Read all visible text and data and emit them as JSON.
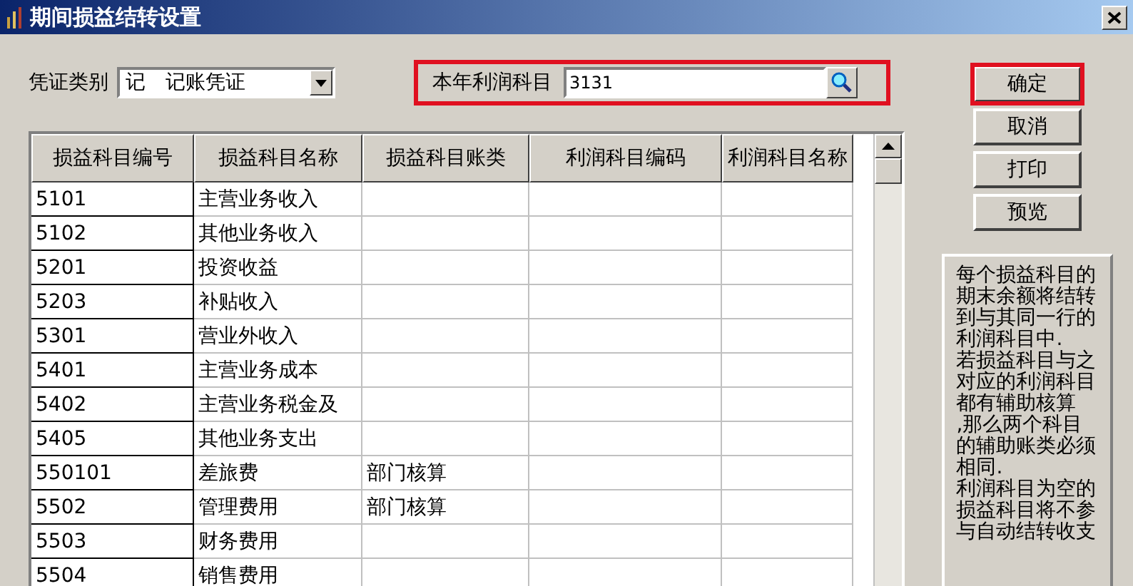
{
  "window": {
    "title": "期间损益结转设置"
  },
  "voucher_type": {
    "label": "凭证类别",
    "code": "记",
    "name": "记账凭证"
  },
  "profit_account": {
    "label": "本年利润科目",
    "value": "3131",
    "highlighted": true
  },
  "buttons": [
    {
      "label": "确定",
      "highlighted": true
    },
    {
      "label": "取消",
      "highlighted": false
    },
    {
      "label": "打印",
      "highlighted": false
    },
    {
      "label": "预览",
      "highlighted": false
    }
  ],
  "table": {
    "columns": [
      "损益科目编号",
      "损益科目名称",
      "损益科目账类",
      "利润科目编码",
      "利润科目名称"
    ],
    "rows": [
      {
        "code": "5101",
        "name": "主营业务收入"
      },
      {
        "code": "5102",
        "name": "其他业务收入"
      },
      {
        "code": "5201",
        "name": "投资收益"
      },
      {
        "code": "5203",
        "name": "补贴收入"
      },
      {
        "code": "5301",
        "name": "营业外收入"
      },
      {
        "code": "5401",
        "name": "主营业务成本"
      },
      {
        "code": "5402",
        "name": "主营业务税金及"
      },
      {
        "code": "5405",
        "name": "其他业务支出"
      },
      {
        "code": "550101",
        "name": "差旅费",
        "aux_type": "部门核算"
      },
      {
        "code": "5502",
        "name": "管理费用",
        "aux_type": "部门核算"
      },
      {
        "code": "5503",
        "name": "财务费用"
      },
      {
        "code": "5504",
        "name": "销售费用"
      }
    ]
  },
  "note": [
    "每个损益科目的",
    "期末余额将结转",
    "到与其同一行的",
    "利润科目中.",
    "若损益科目与之",
    "对应的利润科目",
    "都有辅助核算",
    ",那么两个科目",
    "的辅助账类必须",
    "相同.",
    "利润科目为空的",
    "损益科目将不参",
    "与自动结转收支"
  ]
}
